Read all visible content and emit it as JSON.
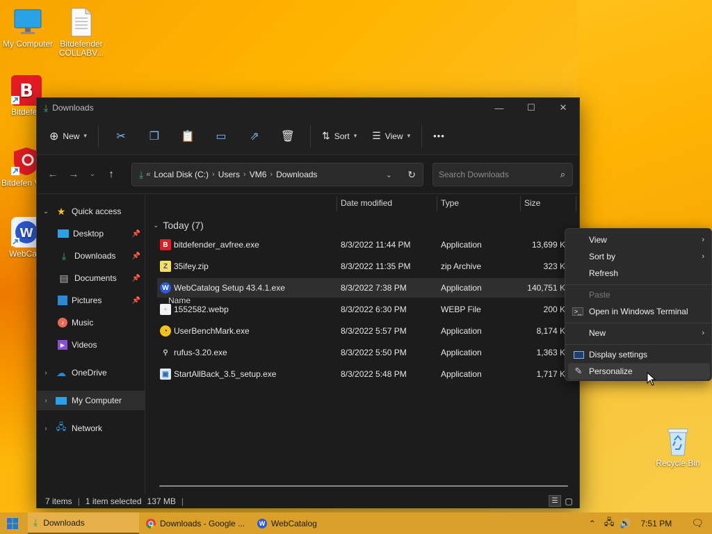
{
  "desktop": {
    "icons": [
      {
        "label": "My Computer"
      },
      {
        "label": "Bitdefender COLLABV..."
      },
      {
        "label": "Bitdefen"
      },
      {
        "label": "Bitdefen VPN"
      },
      {
        "label": "WebCata"
      },
      {
        "label": "Recycle Bin"
      }
    ]
  },
  "window": {
    "title": "Downloads",
    "controls": {
      "minimize": "—",
      "maximize": "☐",
      "close": "✕"
    },
    "toolbar": {
      "new_label": "New",
      "sort_label": "Sort",
      "view_label": "View",
      "more_label": "•••"
    },
    "address": {
      "crumbs": [
        "Local Disk (C:)",
        "Users",
        "VM6",
        "Downloads"
      ],
      "overflow": "«"
    },
    "search": {
      "placeholder": "Search Downloads"
    },
    "nav": {
      "quick_access": "Quick access",
      "items": [
        {
          "label": "Desktop"
        },
        {
          "label": "Downloads"
        },
        {
          "label": "Documents"
        },
        {
          "label": "Pictures"
        },
        {
          "label": "Music"
        },
        {
          "label": "Videos"
        },
        {
          "label": "OneDrive"
        },
        {
          "label": "My Computer"
        },
        {
          "label": "Network"
        }
      ]
    },
    "columns": {
      "name": "Name",
      "date": "Date modified",
      "type": "Type",
      "size": "Size"
    },
    "group": {
      "label": "Today (7)"
    },
    "files": [
      {
        "name": "bitdefender_avfree.exe",
        "date": "8/3/2022 11:44 PM",
        "type": "Application",
        "size": "13,699 K"
      },
      {
        "name": "35ifey.zip",
        "date": "8/3/2022 11:35 PM",
        "type": "zip Archive",
        "size": "323 K"
      },
      {
        "name": "WebCatalog Setup 43.4.1.exe",
        "date": "8/3/2022 7:38 PM",
        "type": "Application",
        "size": "140,751 K"
      },
      {
        "name": "1552582.webp",
        "date": "8/3/2022 6:30 PM",
        "type": "WEBP File",
        "size": "200 K"
      },
      {
        "name": "UserBenchMark.exe",
        "date": "8/3/2022 5:57 PM",
        "type": "Application",
        "size": "8,174 K"
      },
      {
        "name": "rufus-3.20.exe",
        "date": "8/3/2022 5:50 PM",
        "type": "Application",
        "size": "1,363 K"
      },
      {
        "name": "StartAllBack_3.5_setup.exe",
        "date": "8/3/2022 5:48 PM",
        "type": "Application",
        "size": "1,717 K"
      }
    ],
    "status": {
      "items": "7 items",
      "selected": "1 item selected",
      "size": "137 MB"
    }
  },
  "context_menu": {
    "items": [
      {
        "label": "View"
      },
      {
        "label": "Sort by"
      },
      {
        "label": "Refresh"
      },
      {
        "label": "Paste"
      },
      {
        "label": "Open in Windows Terminal"
      },
      {
        "label": "New"
      },
      {
        "label": "Display settings"
      },
      {
        "label": "Personalize"
      }
    ]
  },
  "taskbar": {
    "items": [
      {
        "label": "Downloads"
      },
      {
        "label": "Downloads - Google ..."
      },
      {
        "label": "WebCatalog"
      }
    ],
    "time": "7:51 PM"
  },
  "colors": {
    "accent": "#60cdff",
    "window_bg": "#1f1f1f",
    "taskbar": "#dba02a"
  }
}
